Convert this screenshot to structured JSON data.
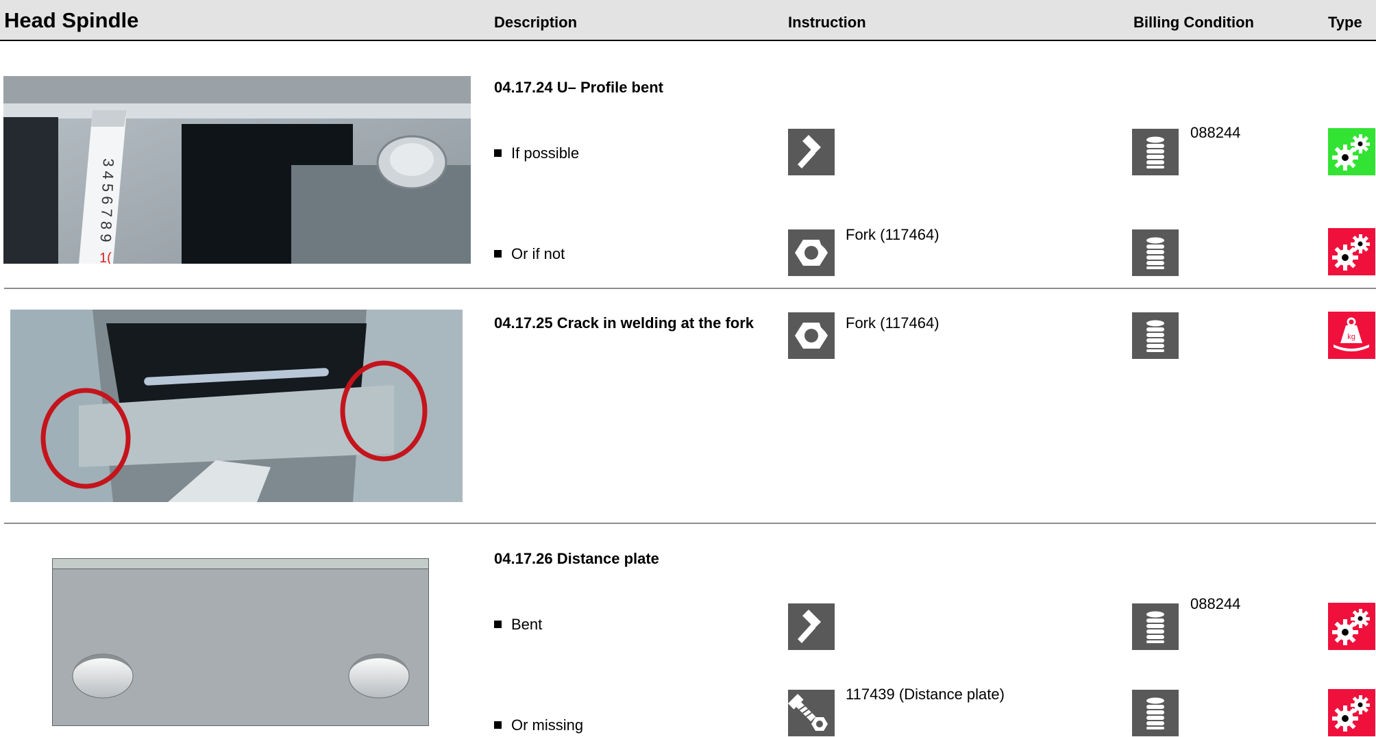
{
  "header": {
    "title": "Head Spindle",
    "col_description": "Description",
    "col_instruction": "Instruction",
    "col_billing": "Billing Condition",
    "col_type": "Type"
  },
  "sections": [
    {
      "heading": "04.17.24 U– Profile bent",
      "image": "photo of bent U-profile with measuring tape and nut",
      "rows": [
        {
          "text": "If possible",
          "instruction_icon": "hammer-icon",
          "instruction_text": "",
          "billing_icon": "coin-stack-icon",
          "billing_text": "088244",
          "type_icon": "gears-icon",
          "type_color": "#33e333"
        },
        {
          "text": "Or if not",
          "instruction_icon": "nut-replace-icon",
          "instruction_text": "Fork (117464)",
          "billing_icon": "coin-stack-icon",
          "billing_text": "",
          "type_icon": "gears-icon",
          "type_color": "#f0103c"
        }
      ]
    },
    {
      "heading": "04.17.25 Crack in welding at the fork",
      "image": "photo of fork welding with two red circles",
      "rows": [
        {
          "text": "",
          "instruction_icon": "nut-replace-icon",
          "instruction_text": "Fork (117464)",
          "billing_icon": "coin-stack-icon",
          "billing_text": "",
          "type_icon": "weight-kg-icon",
          "type_color": "#f0103c"
        }
      ]
    },
    {
      "heading": "04.17.26 Distance plate",
      "image": "drawing of grey distance plate with two holes",
      "rows": [
        {
          "text": "Bent",
          "instruction_icon": "hammer-icon",
          "instruction_text": "",
          "billing_icon": "coin-stack-icon",
          "billing_text": "088244",
          "type_icon": "gears-icon",
          "type_color": "#f0103c"
        },
        {
          "text": "Or missing",
          "instruction_icon": "bolt-nut-icon",
          "instruction_text": "117439 (Distance plate)",
          "billing_icon": "coin-stack-icon",
          "billing_text": "",
          "type_icon": "gears-icon",
          "type_color": "#f0103c"
        }
      ]
    }
  ]
}
